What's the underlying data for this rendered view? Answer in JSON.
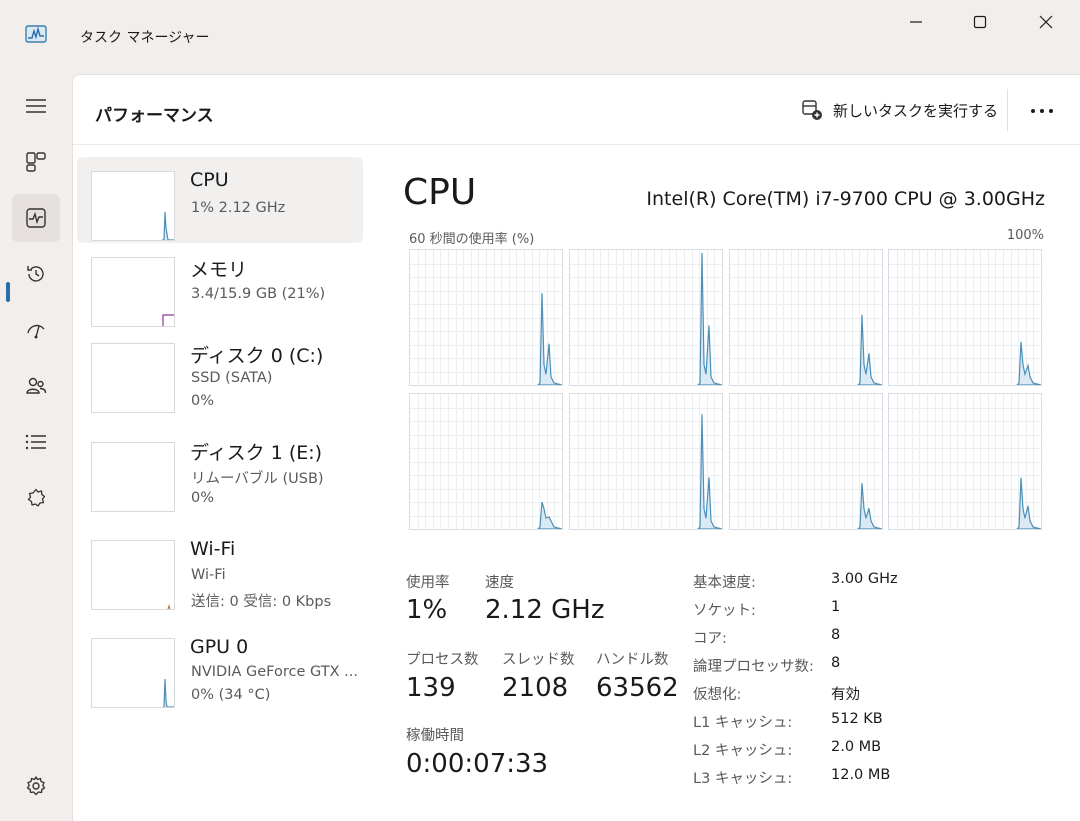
{
  "window": {
    "title": "タスク マネージャー",
    "icon": "task-manager-icon"
  },
  "colors": {
    "accent": "#2a6fa8",
    "graph_line": "#4a90b8",
    "graph_fill": "#dbe9f2",
    "memory": "#8b3a9e",
    "network": "#c8793a"
  },
  "nav": [
    {
      "icon": "hamburger-icon"
    },
    {
      "icon": "processes-icon"
    },
    {
      "icon": "performance-icon",
      "active": true
    },
    {
      "icon": "app-history-icon"
    },
    {
      "icon": "startup-apps-icon"
    },
    {
      "icon": "users-icon"
    },
    {
      "icon": "details-icon"
    },
    {
      "icon": "services-icon"
    },
    {
      "icon": "settings-icon"
    }
  ],
  "header": {
    "title": "パフォーマンス",
    "new_task": "新しいタスクを実行する",
    "more": "more-icon"
  },
  "devices": [
    {
      "name": "CPU",
      "sub1": "1%  2.12 GHz",
      "sub2": "",
      "active": true
    },
    {
      "name": "メモリ",
      "sub1": "3.4/15.9 GB (21%)",
      "sub2": ""
    },
    {
      "name": "ディスク 0 (C:)",
      "sub1": "SSD (SATA)",
      "sub2": "0%"
    },
    {
      "name": "ディスク 1 (E:)",
      "sub1": "リムーバブル (USB)",
      "sub2": "0%"
    },
    {
      "name": "Wi-Fi",
      "sub1": "Wi-Fi",
      "sub2": "送信: 0  受信: 0 Kbps"
    },
    {
      "name": "GPU 0",
      "sub1": "NVIDIA GeForce GTX ...",
      "sub2": "0%  (34 °C)"
    }
  ],
  "detail": {
    "title": "CPU",
    "model": "Intel(R) Core(TM) i7-9700 CPU @ 3.00GHz",
    "graph_label": "60 秒間の使用率 (%)",
    "graph_max": "100%",
    "stats": {
      "usage_label": "使用率",
      "usage": "1%",
      "speed_label": "速度",
      "speed": "2.12 GHz",
      "processes_label": "プロセス数",
      "processes": "139",
      "threads_label": "スレッド数",
      "threads": "2108",
      "handles_label": "ハンドル数",
      "handles": "63562",
      "uptime_label": "稼働時間",
      "uptime": "0:00:07:33"
    },
    "specs": [
      {
        "key": "基本速度:",
        "value": "3.00 GHz"
      },
      {
        "key": "ソケット:",
        "value": "1"
      },
      {
        "key": "コア:",
        "value": "8"
      },
      {
        "key": "論理プロセッサ数:",
        "value": "8"
      },
      {
        "key": "仮想化:",
        "value": "有効"
      },
      {
        "key": "L1 キャッシュ:",
        "value": "512 KB"
      },
      {
        "key": "L2 キャッシュ:",
        "value": "2.0 MB"
      },
      {
        "key": "L3 キャッシュ:",
        "value": "12.0 MB"
      }
    ]
  }
}
